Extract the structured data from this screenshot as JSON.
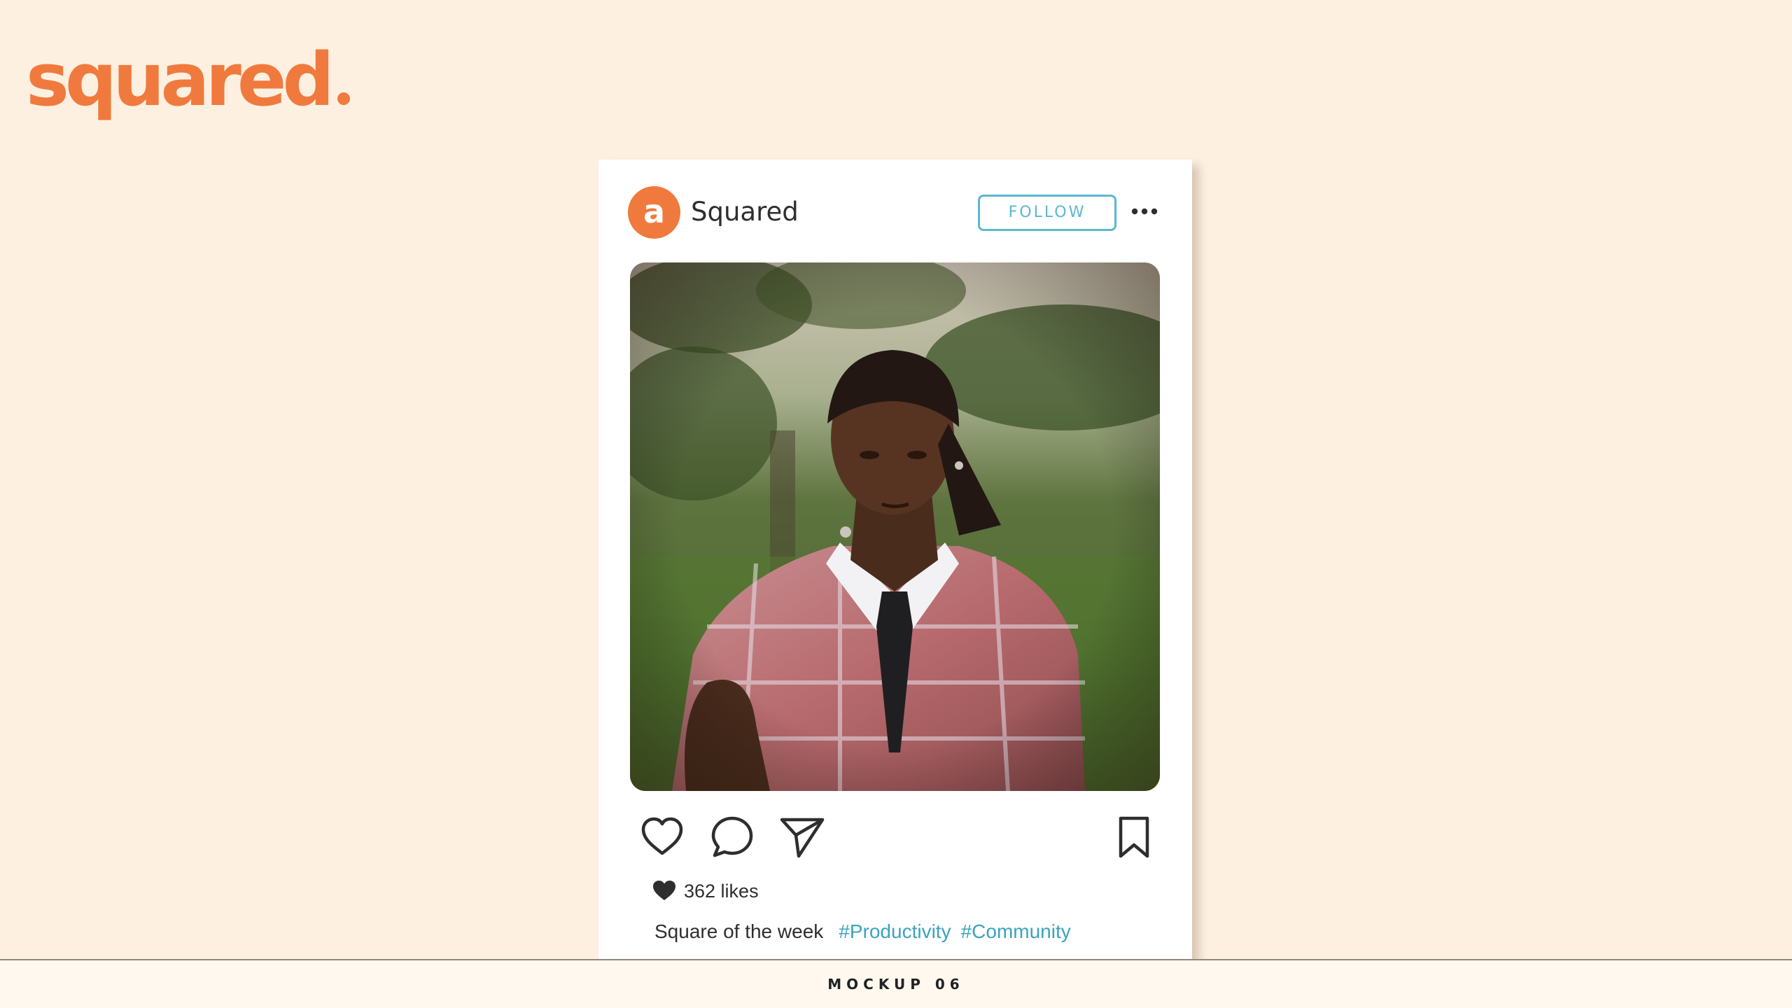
{
  "brand": {
    "logo_text": "squared",
    "accent_color": "#f07a3e"
  },
  "post": {
    "account": {
      "avatar_glyph": "a",
      "name": "Squared"
    },
    "follow_label": "FOLLOW",
    "more_icon": "more-horizontal-icon",
    "image_description_icon": "photo",
    "actions": {
      "like_icon": "heart-icon",
      "comment_icon": "comment-icon",
      "share_icon": "send-icon",
      "save_icon": "bookmark-icon"
    },
    "likes": "362 likes",
    "caption": "Square of the week",
    "hashtags": [
      "#Productivity",
      "#Community"
    ],
    "hashtag_color": "#3aa3bf",
    "follow_color": "#5bb8cf"
  },
  "footer": {
    "label": "MOCKUP 06"
  }
}
